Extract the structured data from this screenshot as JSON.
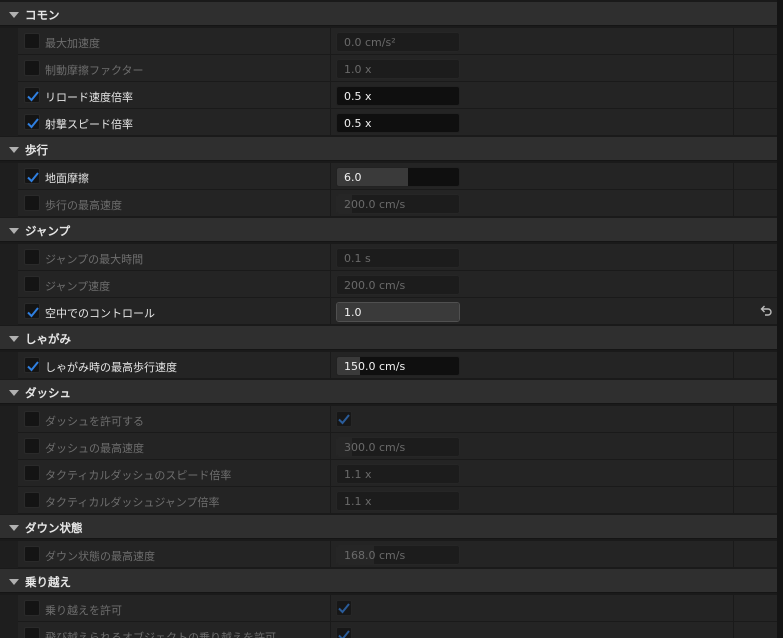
{
  "sections": [
    {
      "title": "コモン",
      "rows": [
        {
          "label": "最大加速度",
          "enabled": false,
          "value": "0.0 cm/s²",
          "fill": 0
        },
        {
          "label": "制動摩擦ファクター",
          "enabled": false,
          "value": "1.0 x",
          "fill": 0
        },
        {
          "label": "リロード速度倍率",
          "enabled": true,
          "value": "0.5 x",
          "fill": 0
        },
        {
          "label": "射撃スピード倍率",
          "enabled": true,
          "value": "0.5 x",
          "fill": 0
        }
      ]
    },
    {
      "title": "歩行",
      "rows": [
        {
          "label": "地面摩擦",
          "enabled": true,
          "value": "6.0",
          "fill": 0.58
        },
        {
          "label": "歩行の最高速度",
          "enabled": false,
          "value": "200.0 cm/s",
          "fill": 0.12
        }
      ]
    },
    {
      "title": "ジャンプ",
      "rows": [
        {
          "label": "ジャンプの最大時間",
          "enabled": false,
          "value": "0.1 s",
          "fill": 0
        },
        {
          "label": "ジャンプ速度",
          "enabled": false,
          "value": "200.0 cm/s",
          "fill": 0
        },
        {
          "label": "空中でのコントロール",
          "enabled": true,
          "value": "1.0",
          "fill": 1.0,
          "reset": "reset-arrow-icon"
        }
      ]
    },
    {
      "title": "しゃがみ",
      "rows": [
        {
          "label": "しゃがみ時の最高歩行速度",
          "enabled": true,
          "value": "150.0 cm/s",
          "fill": 0.19
        }
      ]
    },
    {
      "title": "ダッシュ",
      "rows": [
        {
          "label": "ダッシュを許可する",
          "enabled": false,
          "checkValue": true
        },
        {
          "label": "ダッシュの最高速度",
          "enabled": false,
          "value": "300.0 cm/s",
          "fill": 0.12
        },
        {
          "label": "タクティカルダッシュのスピード倍率",
          "enabled": false,
          "value": "1.1 x",
          "fill": 0
        },
        {
          "label": "タクティカルダッシュジャンプ倍率",
          "enabled": false,
          "value": "1.1 x",
          "fill": 0
        }
      ]
    },
    {
      "title": "ダウン状態",
      "rows": [
        {
          "label": "ダウン状態の最高速度",
          "enabled": false,
          "value": "168.0 cm/s",
          "fill": 0.3
        }
      ]
    },
    {
      "title": "乗り越え",
      "rows": [
        {
          "label": "乗り越えを許可",
          "enabled": false,
          "checkValue": true
        },
        {
          "label": "飛び越えられるオブジェクトの乗り越えを許可",
          "enabled": false,
          "checkValue": true
        }
      ]
    }
  ],
  "colors": {
    "checkmark": "#2f7fe0",
    "checkmark_dim": "#2a5c9a"
  }
}
